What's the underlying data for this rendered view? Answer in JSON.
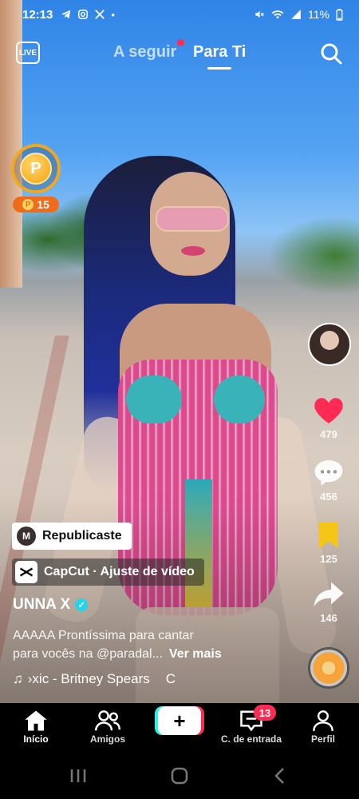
{
  "status_bar": {
    "time": "12:13",
    "battery": "11%",
    "left_icons": [
      "telegram-icon",
      "instagram-icon",
      "x-icon",
      "dot-icon"
    ],
    "right_icons": [
      "mute-icon",
      "wifi-icon",
      "signal-icon",
      "battery-icon"
    ]
  },
  "top_nav": {
    "live_label": "LIVE",
    "tabs": [
      {
        "label": "A seguir",
        "has_notification_dot": true
      },
      {
        "label": "Para Ti",
        "active": true
      }
    ]
  },
  "coin_widget": {
    "symbol": "P",
    "badge_symbol": "P",
    "badge_value": "15",
    "ring_color": "#f0a81c"
  },
  "right_rail": {
    "likes": "479",
    "comments": "456",
    "favorites": "125",
    "shares": "146",
    "like_color": "#fe2c55",
    "favorite_color": "#f5c518"
  },
  "post": {
    "repost_initial": "M",
    "repost_label": "Republicaste",
    "capcut_label": "CapCut · Ajuste de vídeo",
    "username": "UNNA X",
    "verified": true,
    "description_line1": "AAAAA Prontíssima para cantar",
    "description_line2": "para vocês na @paradal...",
    "see_more": "Ver mais",
    "music": "›xic - Britney Spears",
    "music_extra": "C"
  },
  "bottom_nav": {
    "items": [
      {
        "label": "Início",
        "icon": "home-icon",
        "active": true
      },
      {
        "label": "Amigos",
        "icon": "friends-icon"
      },
      {
        "label": "C. de entrada",
        "icon": "inbox-icon",
        "badge": "13"
      },
      {
        "label": "Perfil",
        "icon": "profile-icon"
      }
    ],
    "create_symbol": "+"
  },
  "system_nav": [
    "recents-button",
    "home-button",
    "back-button"
  ]
}
